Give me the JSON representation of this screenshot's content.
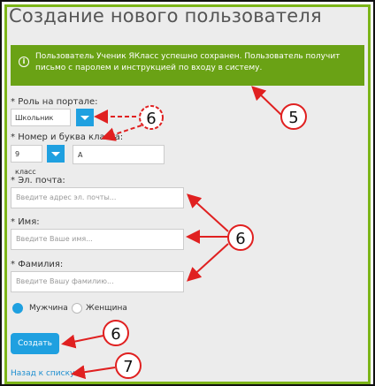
{
  "page": {
    "title": "Создание нового пользователя"
  },
  "alert": {
    "icon": "info-icon",
    "message": "Пользователь Ученик ЯКласс успешно сохранен. Пользователь получит письмо с паролем и инструкцией по входу в систему.",
    "color": "#6aa215"
  },
  "form": {
    "role": {
      "label": "Роль на портале:",
      "value": "Школьник"
    },
    "class": {
      "label": "Номер и буква класса:",
      "number_value": "9 класс",
      "letter_value": "А"
    },
    "email": {
      "label": "Эл. почта:",
      "placeholder": "Введите адрес эл. почты..."
    },
    "name": {
      "label": "Имя:",
      "placeholder": "Введите Ваше имя..."
    },
    "surname": {
      "label": "Фамилия:",
      "placeholder": "Введите Вашу фамилию..."
    },
    "gender": {
      "male": "Мужчина",
      "female": "Женщина",
      "selected": "male"
    },
    "submit_label": "Создать",
    "back_link": "Назад к списку",
    "required_mark": "*"
  },
  "annotations": {
    "labels": [
      "5",
      "6",
      "6",
      "6",
      "7"
    ],
    "arrow_color": "#e02020"
  }
}
